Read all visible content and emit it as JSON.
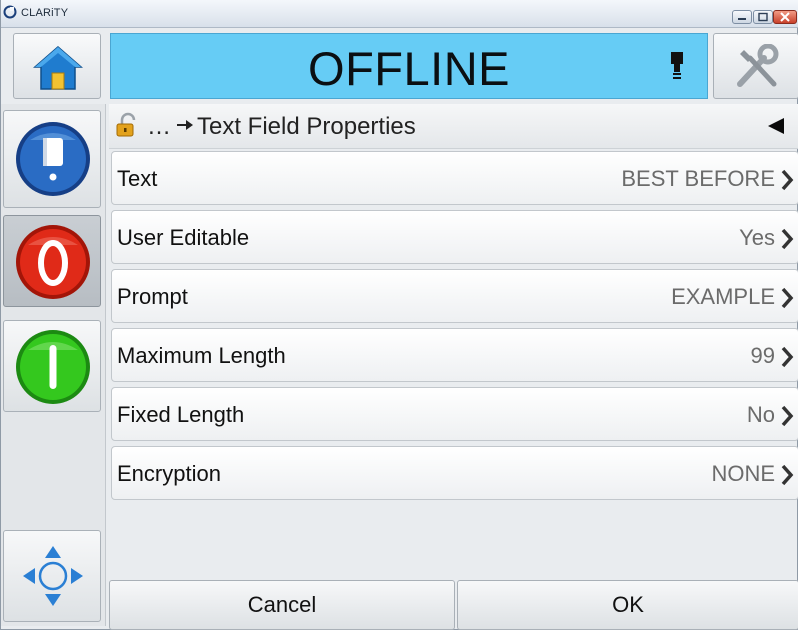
{
  "window": {
    "title": "CLARiTY",
    "controls": [
      "minimize-icon",
      "maximize-icon",
      "close-icon"
    ]
  },
  "header": {
    "status": "OFFLINE",
    "status_color": "#66ccf5",
    "icons": [
      "home-icon",
      "printhead-icon",
      "tools-icon"
    ]
  },
  "sidebar": {
    "buttons": [
      {
        "name": "info",
        "icon": "information-book-icon",
        "color": "#1e5fb4"
      },
      {
        "name": "stop",
        "icon": "stop-icon",
        "color": "#e02a18"
      },
      {
        "name": "start",
        "icon": "start-icon",
        "color": "#34c81e"
      },
      {
        "name": "navigate",
        "icon": "navigation-arrows-icon",
        "color": "#2a7fd4"
      }
    ]
  },
  "breadcrumb": {
    "ellipsis": "…",
    "title": "Text Field Properties",
    "icons": [
      "lock-icon",
      "right-arrow-icon",
      "back-triangle-icon"
    ]
  },
  "properties": [
    {
      "label": "Text",
      "value": "BEST BEFORE"
    },
    {
      "label": "User Editable",
      "value": "Yes"
    },
    {
      "label": "Prompt",
      "value": "EXAMPLE"
    },
    {
      "label": "Maximum Length",
      "value": "99"
    },
    {
      "label": "Fixed Length",
      "value": "No"
    },
    {
      "label": "Encryption",
      "value": "NONE"
    }
  ],
  "footer": {
    "cancel_label": "Cancel",
    "ok_label": "OK"
  }
}
